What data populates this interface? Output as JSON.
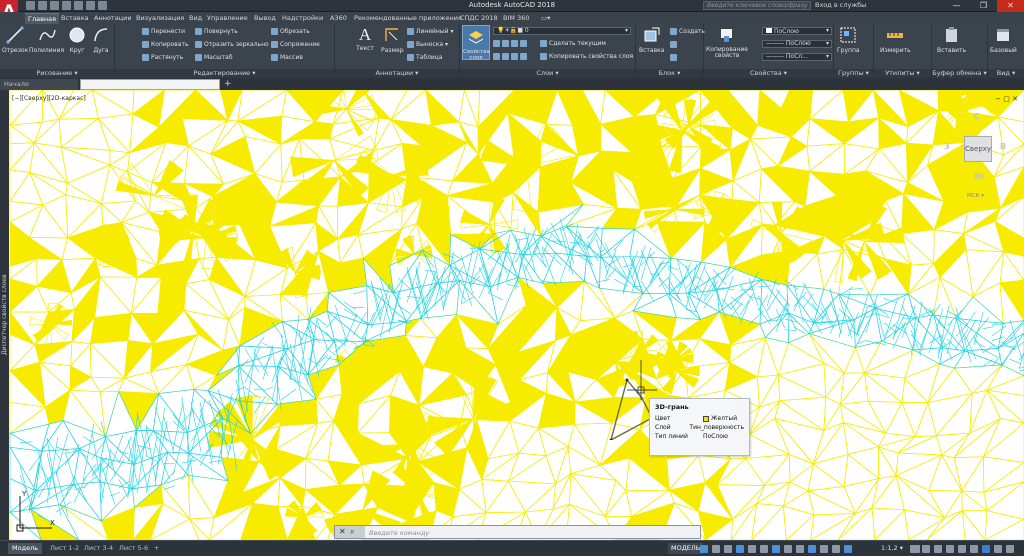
{
  "app": {
    "logo": "A",
    "title": "Autodesk AutoCAD 2018",
    "search_placeholder": "Введите ключевое слово/фразу",
    "signin": "Вход в службы",
    "win_min": "—",
    "win_restore": "❐",
    "win_close": "✕"
  },
  "tabs": [
    "Главная",
    "Вставка",
    "Аннотации",
    "Визуализация",
    "Вид",
    "Управление",
    "Вывод",
    "Надстройки",
    "A360",
    "Рекомендованные приложения",
    "СПДС 2018",
    "BIM 360"
  ],
  "ribbon": {
    "draw": {
      "title": "Рисование",
      "line": "Отрезок",
      "polyline": "Полилиния",
      "circle": "Круг",
      "arc": "Дуга"
    },
    "modify": {
      "title": "Редактирование",
      "move": "Перенести",
      "rotate": "Повернуть",
      "trim": "Обрезать",
      "copy": "Копировать",
      "mirror": "Отразить зеркально",
      "fillet": "Сопряжение",
      "stretch": "Растянуть",
      "scale": "Масштаб",
      "array": "Массив"
    },
    "annotation": {
      "title": "Аннотации",
      "text": "Текст",
      "dimension": "Размер",
      "linear": "Линейный",
      "leader": "Выноска",
      "table": "Таблица"
    },
    "layers": {
      "title": "Слои",
      "properties": "Свойства слоя",
      "current_layer": "0",
      "make_current": "Сделать текущим",
      "match": "Копировать свойства слоя"
    },
    "block": {
      "title": "Блок",
      "insert": "Вставка",
      "create": "Создать"
    },
    "properties": {
      "title": "Свойства",
      "match": "Копирование свойств",
      "color": "ПоСлою",
      "linetype": "ПоСлою",
      "lineweight": "ПоСл..."
    },
    "groups": {
      "title": "Группы",
      "group": "Группа"
    },
    "utilities": {
      "title": "Утилиты",
      "measure": "Измерить"
    },
    "clipboard": {
      "title": "Буфер обмена",
      "paste": "Вставить"
    },
    "view": {
      "title": "Вид",
      "base": "Базовый"
    }
  },
  "doc_tabs": {
    "start": "Начало",
    "add": "+"
  },
  "viewport": {
    "label": "[−][Сверху][2D-каркас]",
    "controls": "− ▢ ✕",
    "viewcube": {
      "top": "Сверху",
      "north": "С",
      "south": "Ю",
      "west": "З",
      "east": "В",
      "wcs": "МСК ▾"
    },
    "palette_label": "Диспетчер свойств слоев"
  },
  "tooltip": {
    "title": "3D-грань",
    "rows": [
      {
        "key": "Цвет",
        "value": "Желтый"
      },
      {
        "key": "Слой",
        "value": "Тин_поверхность"
      },
      {
        "key": "Тип линий",
        "value": "ПоСлою"
      }
    ],
    "swatch": "#f4e300"
  },
  "command": {
    "placeholder": "Введите команду"
  },
  "status": {
    "layouts": [
      "Модель",
      "Лист 1-2",
      "Лист 3-4",
      "Лист 5-6"
    ],
    "add": "+",
    "model": "МОДЕЛЬ",
    "scale": "1:1,2 ▾"
  },
  "colors": {
    "tin": "#f7ec00",
    "river": "#1fd3e3",
    "ucs": "#1a1a1a"
  }
}
